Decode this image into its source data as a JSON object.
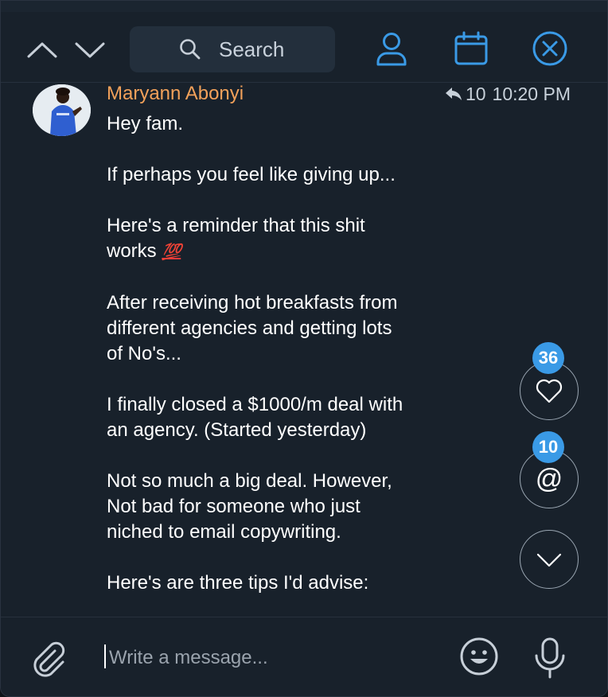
{
  "header": {
    "search_label": "Search"
  },
  "message": {
    "sender": "Maryann Abonyi",
    "reply_count": "10",
    "time": "10:20 PM",
    "paragraphs": [
      [
        "Hey fam."
      ],
      [
        "If perhaps you feel like giving up..."
      ],
      [
        "Here's a reminder that this shit",
        "works"
      ],
      [
        "After receiving hot breakfasts from",
        "different agencies and getting lots",
        "of No's..."
      ],
      [
        "I finally closed a $1000/m deal with",
        "an agency. (Started yesterday)"
      ],
      [
        "Not so much a big deal. However,",
        "Not bad for someone who just",
        "niched to email copywriting."
      ],
      [
        "Here's are three tips I'd advise:"
      ]
    ],
    "emoji_100": "💯"
  },
  "side": {
    "reactions_count": "36",
    "mentions_count": "10",
    "mention_symbol": "@"
  },
  "composer": {
    "placeholder": "Write a message..."
  },
  "colors": {
    "background": "#18212b",
    "accent": "#3a9ae6",
    "sender_name": "#f2a15a",
    "badge": "#3a9ae6"
  },
  "icons": [
    "chevron-up-icon",
    "chevron-down-icon",
    "search-icon",
    "user-icon",
    "calendar-icon",
    "close-icon",
    "reply-icon",
    "heart-icon",
    "chevron-down-icon",
    "paperclip-icon",
    "emoji-icon",
    "microphone-icon"
  ]
}
